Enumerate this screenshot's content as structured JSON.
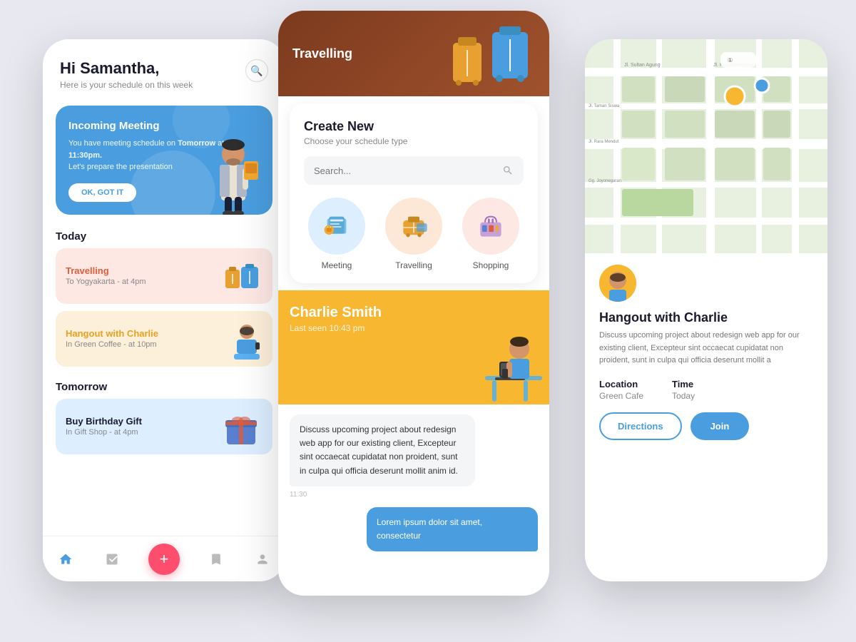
{
  "background": "#e8e9f0",
  "phone1": {
    "greeting": "Hi Samantha,",
    "subtitle": "Here is your schedule on this week",
    "incoming": {
      "title": "Incoming Meeting",
      "desc_prefix": "You have meeting schedule on ",
      "desc_bold": "Tomorrow",
      "desc_suffix": " at ",
      "time": "11:30pm.",
      "desc_end": "Let's prepare the presentation",
      "button": "OK, GOT IT"
    },
    "today_label": "Today",
    "schedules_today": [
      {
        "title": "Travelling",
        "sub": "To Yogyakarta - at 4pm",
        "style": "pink"
      },
      {
        "title": "Hangout with Charlie",
        "sub": "In Green Coffee - at 10pm",
        "style": "yellow"
      }
    ],
    "tomorrow_label": "Tomorrow",
    "schedules_tomorrow": [
      {
        "title": "Buy Birthday Gift",
        "sub": "In Gift Shop - at 4pm",
        "style": "blue"
      }
    ],
    "nav": {
      "home": "⌂",
      "tasks": "☑",
      "add": "+",
      "bookmark": "⊟",
      "profile": "○"
    }
  },
  "phone2": {
    "top_label": "Travelling",
    "create_new": {
      "title": "Create New",
      "subtitle": "Choose your schedule type",
      "search_placeholder": "Search...",
      "icons": [
        {
          "label": "Meeting",
          "emoji": "📋",
          "style": "blue"
        },
        {
          "label": "Travelling",
          "emoji": "🧳",
          "style": "peach"
        },
        {
          "label": "Shopping",
          "emoji": "🛍",
          "style": "pink"
        }
      ]
    },
    "chat": {
      "name": "Charlie Smith",
      "last_seen": "Last seen 10:43 pm",
      "message1": "Discuss upcoming project about redesign web app for our existing client, Excepteur sint occaecat cupidatat non proident, sunt in culpa qui officia deserunt mollit anim id.",
      "time1": "11:30",
      "message2": "Lorem ipsum dolor sit amet, consectetur"
    }
  },
  "phone3": {
    "event_name": "Hangout with Charlie",
    "event_desc": "Discuss upcoming project about redesign web app for our existing client, Excepteur sint occaecat cupidatat non proident, sunt in culpa qui officia deserunt mollit a",
    "location_label": "Location",
    "location_value": "Green Cafe",
    "time_label": "Time",
    "time_value": "Today",
    "directions_button": "Directions",
    "join_button": "Join"
  }
}
